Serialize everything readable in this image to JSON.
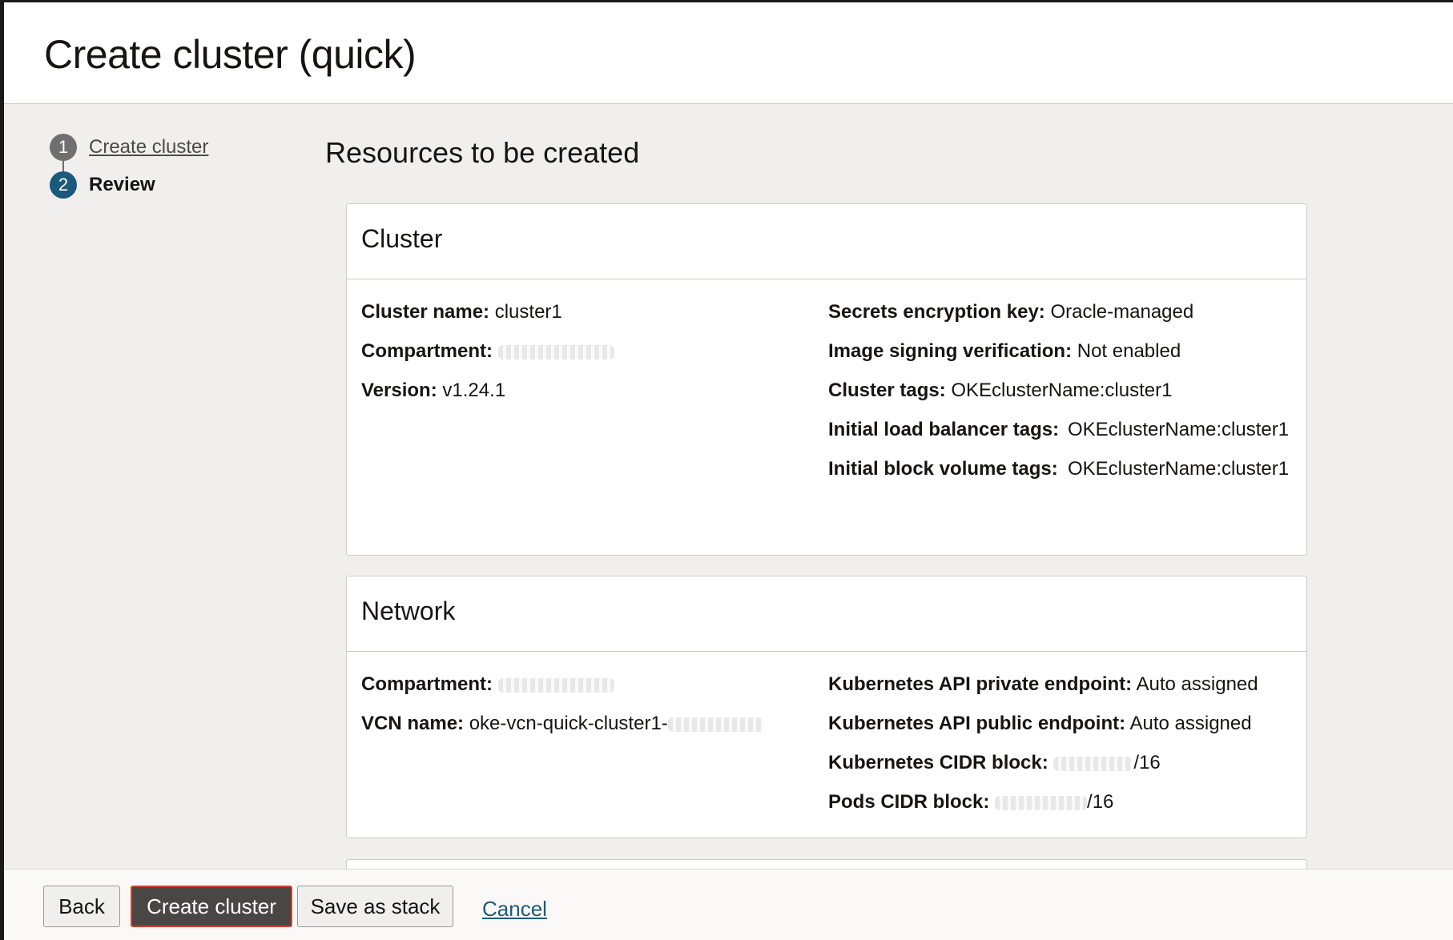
{
  "page": {
    "title": "Create cluster (quick)"
  },
  "steps": [
    {
      "number": "1",
      "label": "Create cluster",
      "state": "done"
    },
    {
      "number": "2",
      "label": "Review",
      "state": "current"
    }
  ],
  "main": {
    "section_title": "Resources to be created"
  },
  "cluster_card": {
    "title": "Cluster",
    "left": [
      {
        "key": "Cluster name:",
        "value": "cluster1"
      },
      {
        "key": "Compartment:",
        "value": ""
      },
      {
        "key": "Version:",
        "value": "v1.24.1"
      }
    ],
    "right": [
      {
        "key": "Secrets encryption key:",
        "value": "Oracle-managed"
      },
      {
        "key": "Image signing verification:",
        "value": "Not enabled"
      },
      {
        "key": "Cluster tags:",
        "value": "OKEclusterName:cluster1"
      }
    ],
    "right_grid": [
      {
        "key": "Initial load balancer tags:",
        "value": "OKEclusterName:cluster1"
      },
      {
        "key": "Initial block volume tags:",
        "value": "OKEclusterName:cluster1"
      }
    ]
  },
  "network_card": {
    "title": "Network",
    "left": [
      {
        "key": "Compartment:",
        "value": ""
      },
      {
        "key": "VCN name:",
        "value": "oke-vcn-quick-cluster1-"
      }
    ],
    "right": [
      {
        "key": "Kubernetes API private endpoint:",
        "value": "Auto assigned"
      },
      {
        "key": "Kubernetes API public endpoint:",
        "value": "Auto assigned"
      },
      {
        "key": "Kubernetes CIDR block:",
        "value": "/16"
      },
      {
        "key": "Pods CIDR block:",
        "value": "/16"
      }
    ]
  },
  "footer": {
    "back_label": "Back",
    "create_label": "Create cluster",
    "save_stack_label": "Save as stack",
    "cancel_label": "Cancel"
  },
  "colors": {
    "current_step": "#1b5a7a",
    "primary_button": "#4a4643",
    "primary_button_focus": "#c74634",
    "link": "#1b5a7a"
  }
}
